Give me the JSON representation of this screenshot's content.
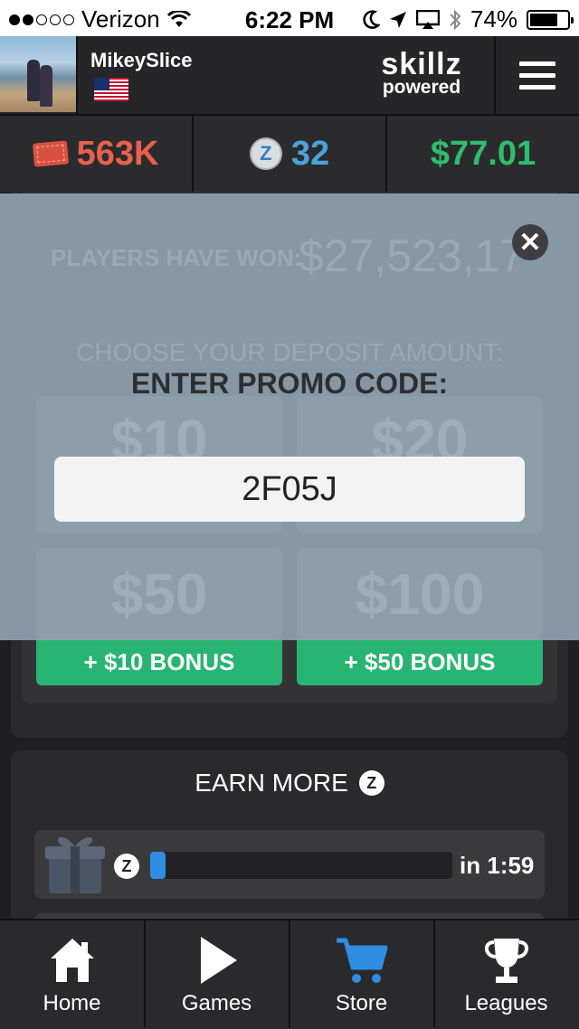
{
  "status_bar": {
    "carrier": "Verizon",
    "time": "6:22 PM",
    "battery": "74%",
    "battery_level": 0.74
  },
  "header": {
    "username": "MikeySlice",
    "brand_line1": "skillz",
    "brand_line2": "powered"
  },
  "currency": {
    "tickets": "563K",
    "z_coins": "32",
    "cash": "$77.01",
    "z_symbol": "Z",
    "colors": {
      "tickets": "#e8604e",
      "z": "#4aa3d9",
      "cash": "#2fbd6e"
    }
  },
  "deposit": {
    "players_have_won_label": "PLAYERS HAVE WON:",
    "players_have_won_value": "$27,523,17",
    "choose_label": "CHOOSE YOUR DEPOSIT AMOUNT:",
    "amounts": [
      "$10",
      "$20",
      "$50",
      "$100"
    ],
    "bonuses": [
      "+ $10 BONUS",
      "+ $50 BONUS"
    ]
  },
  "promo": {
    "title": "ENTER PROMO CODE:",
    "value": "2F05J",
    "close_symbol": "✕"
  },
  "earn_more": {
    "title": "EARN MORE",
    "z_symbol": "Z",
    "timer": "in 1:59",
    "progress": 0.05
  },
  "tabs": [
    {
      "label": "Home",
      "icon": "home-icon",
      "active": false
    },
    {
      "label": "Games",
      "icon": "play-icon",
      "active": false
    },
    {
      "label": "Store",
      "icon": "cart-icon",
      "active": true
    },
    {
      "label": "Leagues",
      "icon": "trophy-icon",
      "active": false
    }
  ],
  "accent_color": "#2f8de4"
}
